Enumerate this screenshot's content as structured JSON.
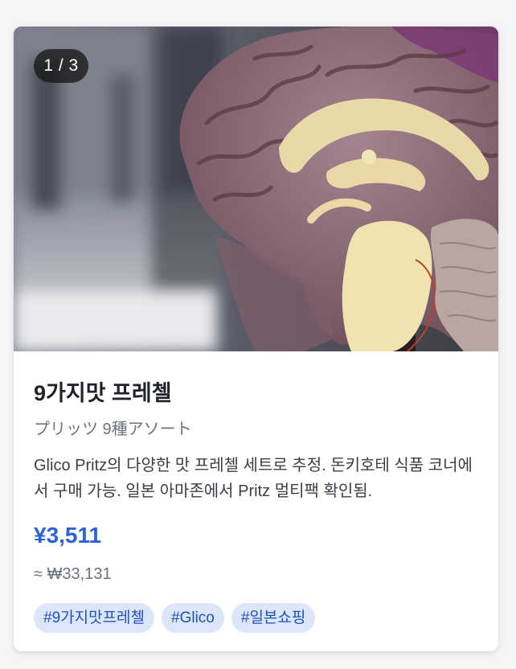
{
  "gallery": {
    "counter": "1 / 3",
    "image_subject": "brain-model-photo"
  },
  "product": {
    "title": "9가지맛 프레첼",
    "subtitle": "プリッツ 9種アソート",
    "description": "Glico Pritz의 다양한 맛 프레첼 세트로 추정. 돈키호테 식품 코너에서 구매 가능. 일본 아마존에서 Pritz 멀티팩 확인됨.",
    "price": "¥3,511",
    "converted_price": "≈ ₩33,131"
  },
  "tags": [
    "#9가지맛프레첼",
    "#Glico",
    "#일본쇼핑"
  ],
  "colors": {
    "accent": "#2b62d6",
    "tag_bg": "#dbe6fb",
    "tag_text": "#2350b8",
    "counter_bg": "#181818"
  }
}
